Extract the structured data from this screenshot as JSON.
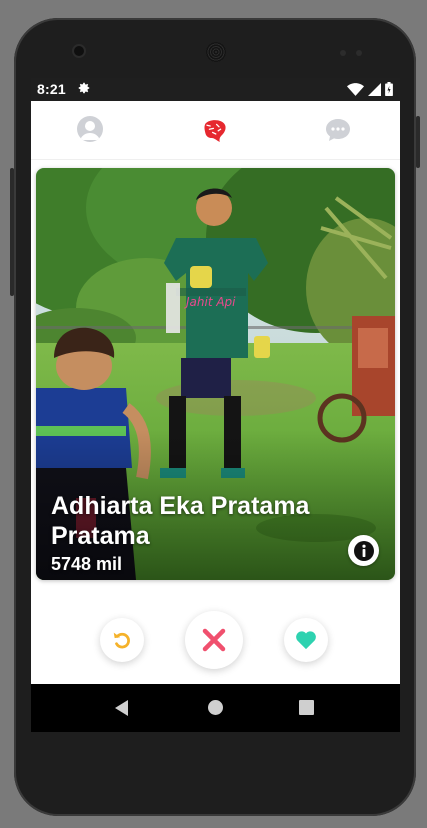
{
  "status_bar": {
    "time": "8:21",
    "settings_icon": "gear-icon",
    "wifi_icon": "wifi-icon",
    "signal_icon": "cell-signal-icon",
    "battery_icon": "battery-icon"
  },
  "app_bar": {
    "profile_icon": "profile-icon",
    "logo_icon": "app-logo-icon",
    "chat_icon": "chat-icon",
    "inactive_color": "#cfd1d6",
    "logo_color": "#e6282f"
  },
  "card": {
    "name": "Adhiarta Eka Pratama Pratama",
    "distance": "5748 mil",
    "info_icon": "info-icon",
    "shirt_print": "Jahit Api"
  },
  "actions": {
    "rewind_icon": "undo-icon",
    "rewind_color": "#f5b22a",
    "nope_icon": "close-icon",
    "nope_color": "#f0506e",
    "like_icon": "heart-icon",
    "like_color": "#2ed2b0"
  },
  "navigation": {
    "back_icon": "back-icon",
    "home_icon": "home-icon",
    "recents_icon": "recents-icon"
  }
}
